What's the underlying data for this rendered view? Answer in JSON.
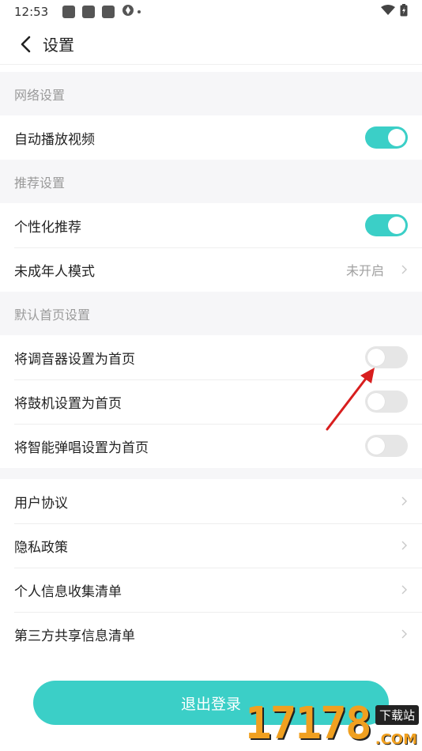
{
  "status_bar": {
    "time": "12:53"
  },
  "nav": {
    "title": "设置"
  },
  "sections": {
    "network": {
      "header": "网络设置",
      "autoplay_label": "自动播放视频",
      "autoplay_on": true
    },
    "recommend": {
      "header": "推荐设置",
      "personalized_label": "个性化推荐",
      "personalized_on": true,
      "minor_mode_label": "未成年人模式",
      "minor_mode_value": "未开启"
    },
    "homepage": {
      "header": "默认首页设置",
      "tuner_label": "将调音器设置为首页",
      "tuner_on": false,
      "drum_label": "将鼓机设置为首页",
      "drum_on": false,
      "smart_label": "将智能弹唱设置为首页",
      "smart_on": false
    },
    "legal": {
      "user_agreement": "用户协议",
      "privacy_policy": "隐私政策",
      "personal_info_list": "个人信息收集清单",
      "third_party_list": "第三方共享信息清单"
    }
  },
  "logout_label": "退出登录",
  "watermark": {
    "number": "17178",
    "badge": "下载站",
    "domain": ".COM"
  },
  "colors": {
    "accent": "#3bcfc7",
    "section_bg": "#f6f6f8",
    "annotation_arrow": "#d81e1e"
  }
}
